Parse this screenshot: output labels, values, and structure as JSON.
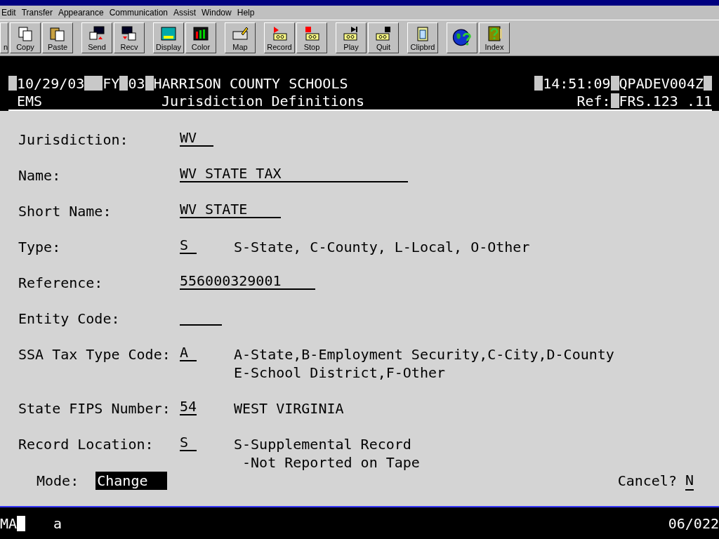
{
  "menu": [
    "Edit",
    "Transfer",
    "Appearance",
    "Communication",
    "Assist",
    "Window",
    "Help"
  ],
  "toolbar": [
    {
      "label": "n"
    },
    {
      "label": "Copy"
    },
    {
      "label": "Paste"
    },
    {
      "label": "Send"
    },
    {
      "label": "Recv"
    },
    {
      "label": "Display"
    },
    {
      "label": "Color"
    },
    {
      "label": "Map"
    },
    {
      "label": "Record"
    },
    {
      "label": "Stop"
    },
    {
      "label": "Play"
    },
    {
      "label": "Quit"
    },
    {
      "label": "Clipbrd"
    },
    {
      "kind": "icon"
    },
    {
      "label": "Index"
    }
  ],
  "header": {
    "date": "10/29/03",
    "fy_label": "FY",
    "fy": "03",
    "org": "HARRISON COUNTY SCHOOLS",
    "time": "14:51:09",
    "terminal": "QPADEV004Z",
    "system": "EMS",
    "title": "Jurisdiction Definitions",
    "ref_label": "Ref:",
    "ref": "FRS.123 .11"
  },
  "fields": [
    {
      "label": "Jurisdiction:",
      "value": "WV"
    },
    {
      "label": "Name:",
      "value": "WV STATE TAX"
    },
    {
      "label": "Short Name:",
      "value": "WV STATE"
    },
    {
      "label": "Type:",
      "value": "S",
      "hint": [
        "S-State, C-County, L-Local, O-Other"
      ]
    },
    {
      "label": "Reference:",
      "value": "556000329001"
    },
    {
      "label": "Entity Code:"
    },
    {
      "label": "SSA Tax Type Code:",
      "value": "A",
      "hint": [
        "A-State,B-Employment Security,C-City,D-County",
        "E-School District,F-Other"
      ]
    },
    {
      "label": "State FIPS Number:",
      "value": "54",
      "hint": [
        "WEST VIRGINIA"
      ]
    },
    {
      "label": "Record Location:",
      "value": "S",
      "hint": [
        "S-Supplemental Record",
        " -Not Reported on Tape"
      ]
    }
  ],
  "mode_label": "Mode:",
  "mode": "Change",
  "cancel_label": "Cancel?",
  "cancel": "N",
  "status": {
    "left": "MA",
    "cursor_char": "a",
    "position": "06/022"
  }
}
